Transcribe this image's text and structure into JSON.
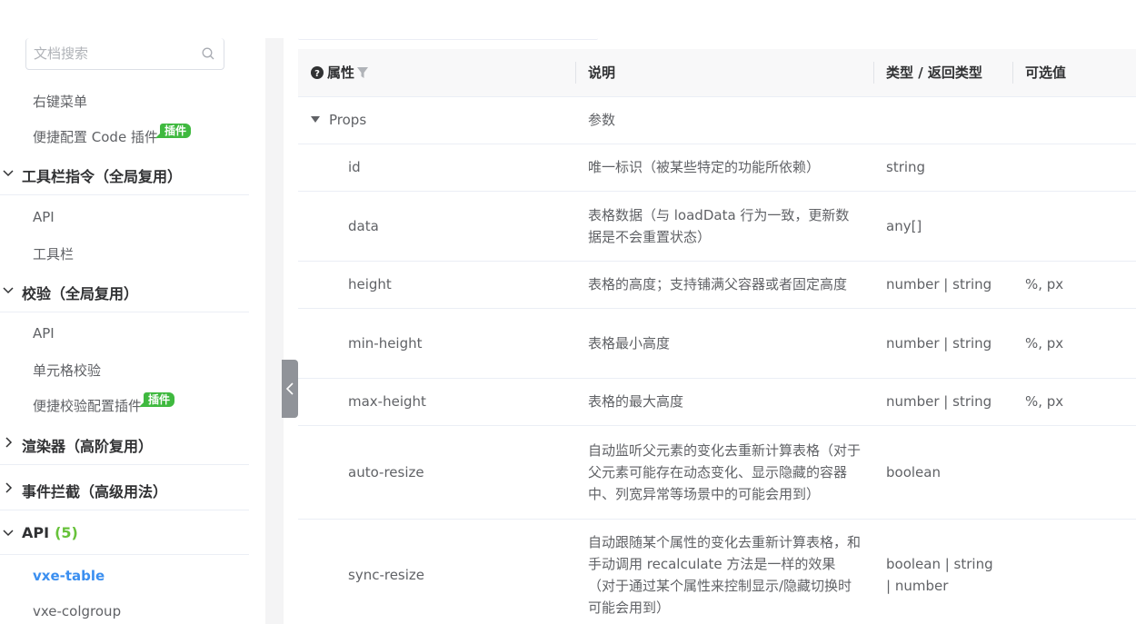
{
  "sidebar": {
    "search_placeholder": "文档搜索",
    "items": [
      {
        "label": "右键菜单"
      },
      {
        "label": "便捷配置 Code 插件",
        "badge": "插件"
      }
    ],
    "groups": [
      {
        "label": "工具栏指令（全局复用）",
        "expanded": true,
        "items": [
          "API",
          "工具栏"
        ]
      },
      {
        "label": "校验（全局复用）",
        "expanded": true,
        "items": [
          "API",
          "单元格校验",
          "便捷校验配置插件"
        ],
        "badge": "插件"
      },
      {
        "label": "渲染器（高阶复用）",
        "expanded": false
      },
      {
        "label": "事件拦截（高级用法）",
        "expanded": false
      },
      {
        "label": "API",
        "count": "(5)",
        "expanded": true,
        "items": [
          "vxe-table",
          "vxe-colgroup"
        ],
        "active": "vxe-table"
      }
    ]
  },
  "table": {
    "headers": {
      "name": "属性",
      "desc": "说明",
      "type": "类型 / 返回类型",
      "options": "可选值"
    },
    "group_row": {
      "name": "Props",
      "desc": "参数"
    },
    "rows": [
      {
        "name": "id",
        "desc": "唯一标识（被某些特定的功能所依赖）",
        "type": "string",
        "options": ""
      },
      {
        "name": "data",
        "desc": "表格数据（与 loadData 行为一致，更新数据是不会重置状态）",
        "type": "any[]",
        "options": ""
      },
      {
        "name": "height",
        "desc": "表格的高度；支持铺满父容器或者固定高度",
        "type": "number | string",
        "options": "%, px"
      },
      {
        "name": "min-height",
        "desc": "表格最小高度",
        "type": "number | string",
        "options": "%, px"
      },
      {
        "name": "max-height",
        "desc": "表格的最大高度",
        "type": "number | string",
        "options": "%, px"
      },
      {
        "name": "auto-resize",
        "desc": "自动监听父元素的变化去重新计算表格（对于父元素可能存在动态变化、显示隐藏的容器中、列宽异常等场景中的可能会用到）",
        "type": "boolean",
        "options": ""
      },
      {
        "name": "sync-resize",
        "desc": "自动跟随某个属性的变化去重新计算表格，和手动调用 recalculate 方法是一样的效果（对于通过某个属性来控制显示/隐藏切换时可能会用到）",
        "type": "boolean | string | number",
        "options": ""
      }
    ]
  },
  "colors": {
    "accent": "#3b8ff0",
    "badge": "#3fb93f",
    "count": "#67c23a"
  }
}
